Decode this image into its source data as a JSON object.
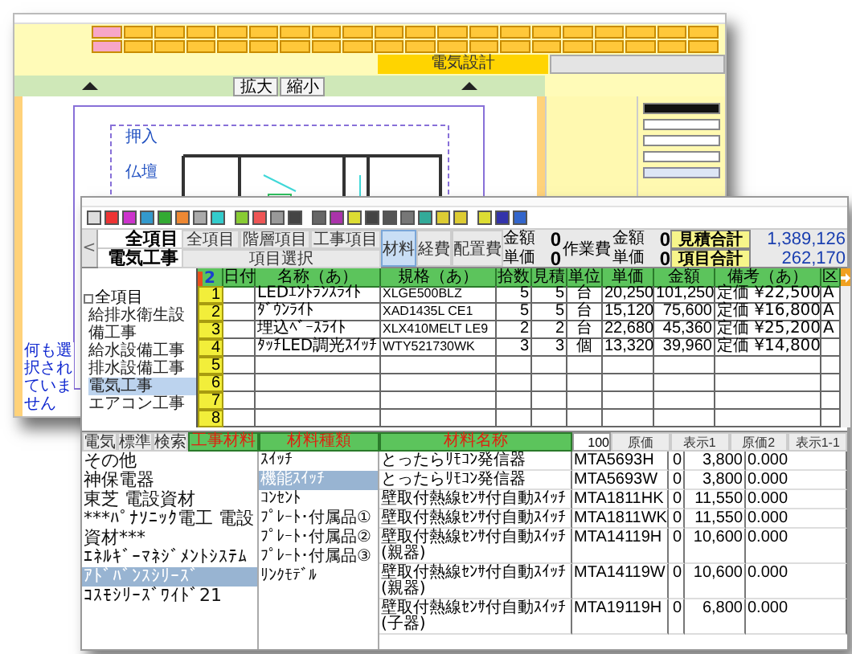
{
  "cad_window": {
    "active_sheet": "電気設計",
    "view_buttons": [
      "拡大",
      "縮小"
    ],
    "plan_labels": [
      "押入",
      "仏壇"
    ],
    "status": "何も選択されていません"
  },
  "estimate_window": {
    "nav_button": "<",
    "title": "全項目",
    "subtitle": "電気工事",
    "scopes": [
      "全項目",
      "階層項目",
      "工事項目"
    ],
    "scope_select": "項目選択",
    "categories": [
      {
        "label": "材料",
        "selected": true
      },
      {
        "label": "経費",
        "selected": false
      },
      {
        "label": "配置費",
        "selected": false
      }
    ],
    "material_cost": {
      "amount_label": "金額",
      "amount": "0",
      "unit_label": "単価",
      "unit": "0"
    },
    "labor_cost": {
      "label": "作業費",
      "amount_label": "金額",
      "amount": "0",
      "unit_label": "単価",
      "unit": "0"
    },
    "totals": [
      {
        "label": "見積合計",
        "value": "1,389,126"
      },
      {
        "label": "項目合計",
        "value": "262,170"
      }
    ],
    "tree": {
      "label": "全項目",
      "expanded": true,
      "children": [
        {
          "label": "給排水衛生設備工事",
          "selected": false
        },
        {
          "label": "給水設備工事",
          "selected": false
        },
        {
          "label": "排水設備工事",
          "selected": false
        },
        {
          "label": "電気工事",
          "selected": true
        },
        {
          "label": "エアコン工事",
          "selected": false
        }
      ]
    },
    "grid": {
      "corner": "2",
      "columns": [
        "日付",
        "名称（あ）",
        "規格（あ）",
        "拾数",
        "見積",
        "単位",
        "単価",
        "金額",
        "備考（あ）",
        "区"
      ],
      "rows": [
        {
          "number": "1",
          "name": "LEDｴﾝﾄﾗﾝｽﾗｲﾄ",
          "spec": "XLGE500BLZ",
          "count": "5",
          "quote": "5",
          "unit": "台",
          "unit_price": "20,250",
          "amount": "101,250",
          "note": "定価 ¥22,500",
          "class": "A"
        },
        {
          "number": "2",
          "name": "ﾀﾞｳﾝﾗｲﾄ",
          "spec": "XAD1435L CE1",
          "count": "5",
          "quote": "5",
          "unit": "台",
          "unit_price": "15,120",
          "amount": "75,600",
          "note": "定価 ¥16,800",
          "class": "A"
        },
        {
          "number": "3",
          "name": "埋込ﾍﾞｰｽﾗｲﾄ",
          "spec": "XLX410MELT LE9",
          "count": "2",
          "quote": "2",
          "unit": "台",
          "unit_price": "22,680",
          "amount": "45,360",
          "note": "定価 ¥25,200",
          "class": "A"
        },
        {
          "number": "4",
          "name": "ﾀｯﾁLED調光ｽｲｯﾁ",
          "spec": "WTY521730WK",
          "count": "3",
          "quote": "3",
          "unit": "個",
          "unit_price": "13,320",
          "amount": "39,960",
          "note": "定価 ¥14,800"
        },
        {
          "number": "5"
        },
        {
          "number": "6"
        },
        {
          "number": "7"
        },
        {
          "number": "8"
        }
      ]
    },
    "bottom": {
      "tabs": [
        "電気",
        "標準",
        "検索"
      ],
      "headers": [
        "工事材料",
        "材料種類",
        "材料名称"
      ],
      "quantity": "100",
      "buttons": [
        "原価",
        "表示1",
        "原価2",
        "表示1-1"
      ],
      "makers": [
        {
          "label": "その他",
          "selected": false
        },
        {
          "label": "神保電器",
          "selected": false
        },
        {
          "label": "東芝 電設資材",
          "selected": false
        },
        {
          "label": "***ﾊﾟﾅｿﾆｯｸ電工 電設資材***",
          "selected": false
        },
        {
          "label": "ｴﾈﾙｷﾞｰﾏﾈｼﾞﾒﾝﾄｼｽﾃﾑ",
          "selected": false
        },
        {
          "label": "ｱﾄﾞﾊﾞﾝｽｼﾘｰｽﾞ",
          "selected": true
        },
        {
          "label": "ｺｽﾓｼﾘｰｽﾞﾜｲﾄﾞ21",
          "selected": false
        }
      ],
      "types": [
        {
          "label": "ｽｲｯﾁ",
          "selected": false
        },
        {
          "label": "機能ｽｲｯﾁ",
          "selected": true
        },
        {
          "label": "ｺﾝｾﾝﾄ",
          "selected": false
        },
        {
          "label": "ﾌﾟﾚｰﾄ･付属品①",
          "selected": false
        },
        {
          "label": "ﾌﾟﾚｰﾄ･付属品②",
          "selected": false
        },
        {
          "label": "ﾌﾟﾚｰﾄ･付属品③",
          "selected": false
        },
        {
          "label": "ﾘﾝｸﾓﾃﾞﾙ",
          "selected": false
        }
      ],
      "materials": [
        {
          "name": "とったらﾘﾓｺﾝ発信器",
          "code": "MTA5693H",
          "stock": "0",
          "price": "3,800",
          "rate": "0.000"
        },
        {
          "name": "とったらﾘﾓｺﾝ発信器",
          "code": "MTA5693W",
          "stock": "0",
          "price": "3,800",
          "rate": "0.000"
        },
        {
          "name": "壁取付熱線ｾﾝｻ付自動ｽｲｯﾁ",
          "code": "MTA1811HK",
          "stock": "0",
          "price": "11,550",
          "rate": "0.000"
        },
        {
          "name": "壁取付熱線ｾﾝｻ付自動ｽｲｯﾁ",
          "code": "MTA1811WK",
          "stock": "0",
          "price": "11,550",
          "rate": "0.000"
        },
        {
          "name": "壁取付熱線ｾﾝｻ付自動ｽｲｯﾁ(親器)",
          "code": "MTA14119H",
          "stock": "0",
          "price": "10,600",
          "rate": "0.000"
        },
        {
          "name": "壁取付熱線ｾﾝｻ付自動ｽｲｯﾁ(親器)",
          "code": "MTA14119W",
          "stock": "0",
          "price": "10,600",
          "rate": "0.000"
        },
        {
          "name": "壁取付熱線ｾﾝｻ付自動ｽｲｯﾁ(子器)",
          "code": "MTA19119H",
          "stock": "0",
          "price": "6,800",
          "rate": "0.000"
        }
      ]
    }
  }
}
